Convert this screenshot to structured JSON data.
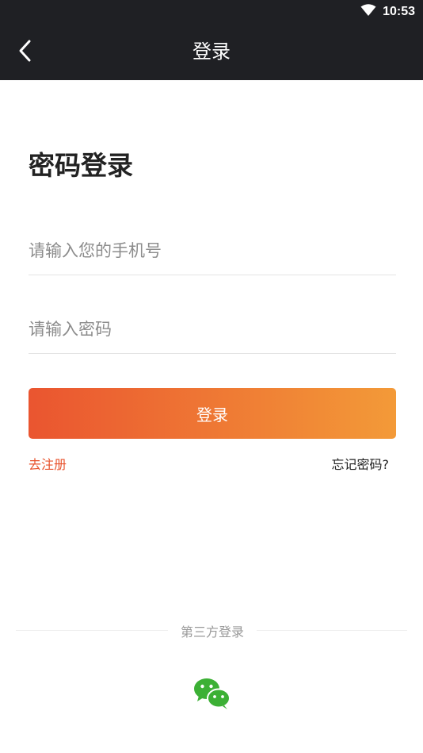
{
  "status_bar": {
    "time": "10:53",
    "wifi_icon": "wifi-icon"
  },
  "header": {
    "title": "登录",
    "back_icon": "chevron-left-icon"
  },
  "page": {
    "heading": "密码登录"
  },
  "form": {
    "phone_placeholder": "请输入您的手机号",
    "phone_value": "",
    "password_placeholder": "请输入密码",
    "password_value": "",
    "login_label": "登录"
  },
  "links": {
    "register": "去注册",
    "forgot_password": "忘记密码?"
  },
  "third_party": {
    "label": "第三方登录",
    "wechat_icon": "wechat-icon"
  },
  "colors": {
    "bar_background": "#1f2024",
    "accent_start": "#ea5530",
    "accent_end": "#f39a38",
    "register_link": "#e8532d",
    "wechat_green": "#3cb035"
  }
}
